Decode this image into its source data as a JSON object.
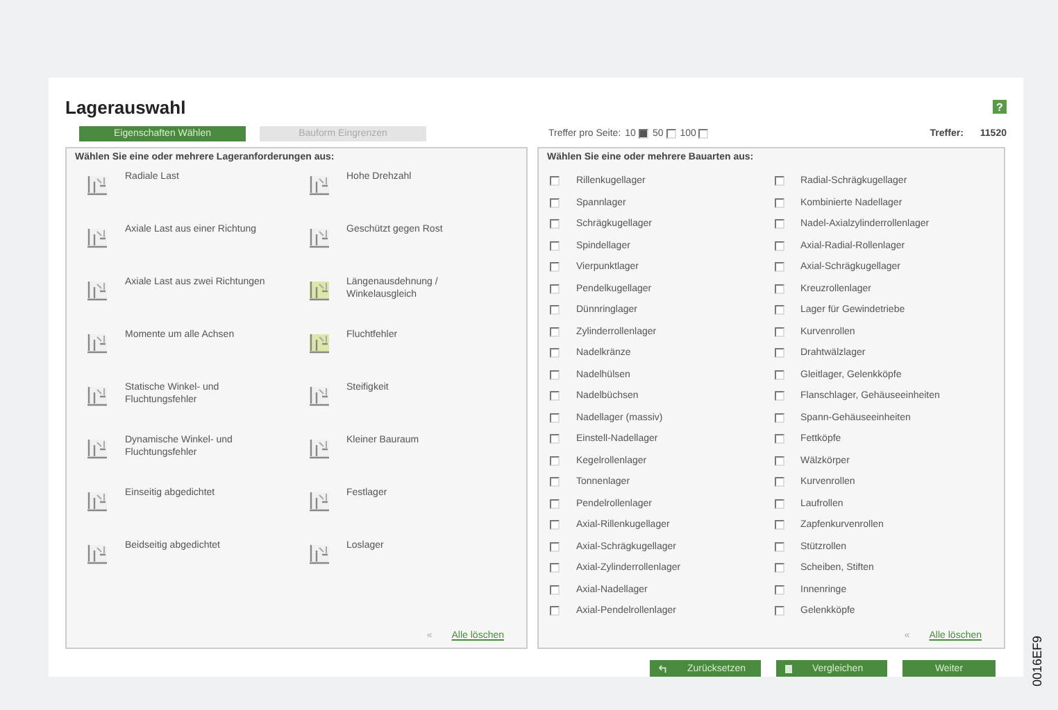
{
  "window": {
    "title": "Lagerauswahl",
    "help": "?"
  },
  "tabs": [
    {
      "label": "Eigenschaften Wählen",
      "selected": true
    },
    {
      "label": "Bauform Eingrenzen",
      "selected": false
    }
  ],
  "per_page": {
    "label": "Treffer pro Seite:",
    "options": [
      {
        "label": "10",
        "selected": true
      },
      {
        "label": "50",
        "selected": false
      },
      {
        "label": "100",
        "selected": false
      }
    ]
  },
  "hits": {
    "label": "Treffer:",
    "value": "11520"
  },
  "requirements": {
    "heading": "Wählen Sie eine oder mehrere Lageranforderungen aus:",
    "items": [
      {
        "label": "Radiale Last",
        "highlight": false
      },
      {
        "label": "Hohe Drehzahl",
        "highlight": false
      },
      {
        "label": "Axiale Last aus einer Richtung",
        "highlight": false
      },
      {
        "label": "Geschützt gegen Rost",
        "highlight": false
      },
      {
        "label": "Axiale Last aus zwei Richtungen",
        "highlight": false
      },
      {
        "label": "Längenausdehnung / Winkelausgleich",
        "highlight": true
      },
      {
        "label": "Momente um alle Achsen",
        "highlight": false
      },
      {
        "label": "Fluchtfehler",
        "highlight": true
      },
      {
        "label": "Statische Winkel- und Fluchtungsfehler",
        "highlight": false
      },
      {
        "label": "Steifigkeit",
        "highlight": false
      },
      {
        "label": "Dynamische Winkel- und Fluchtungsfehler",
        "highlight": false
      },
      {
        "label": "Kleiner Bauraum",
        "highlight": false
      },
      {
        "label": "Einseitig abgedichtet",
        "highlight": false
      },
      {
        "label": "Festlager",
        "highlight": false
      },
      {
        "label": "Beidseitig abgedichtet",
        "highlight": false
      },
      {
        "label": "Loslager",
        "highlight": false
      }
    ],
    "clear_icon": "«",
    "clear": "Alle löschen"
  },
  "types": {
    "heading": "Wählen Sie eine oder mehrere Bauarten aus:",
    "items": [
      {
        "label": "Rillenkugellager",
        "checked": false
      },
      {
        "label": "Radial-Schrägkugellager",
        "checked": false
      },
      {
        "label": "Spannlager",
        "checked": false
      },
      {
        "label": "Kombinierte Nadellager",
        "checked": false
      },
      {
        "label": "Schrägkugellager",
        "checked": false
      },
      {
        "label": "Nadel-Axialzylinderrollenlager",
        "checked": false
      },
      {
        "label": "Spindellager",
        "checked": false
      },
      {
        "label": "Axial-Radial-Rollenlager",
        "checked": false
      },
      {
        "label": "Vierpunktlager",
        "checked": false
      },
      {
        "label": "Axial-Schrägkugellager",
        "checked": false
      },
      {
        "label": "Pendelkugellager",
        "checked": false
      },
      {
        "label": "Kreuzrollenlager",
        "checked": false
      },
      {
        "label": "Dünnringlager",
        "checked": false
      },
      {
        "label": "Lager für Gewindetriebe",
        "checked": false
      },
      {
        "label": "Zylinderrollenlager",
        "checked": false
      },
      {
        "label": "Kurvenrollen",
        "checked": false
      },
      {
        "label": "Nadelkränze",
        "checked": false
      },
      {
        "label": "Drahtwälzlager",
        "checked": false
      },
      {
        "label": "Nadelhülsen",
        "checked": false
      },
      {
        "label": "Gleitlager, Gelenkköpfe",
        "checked": false
      },
      {
        "label": "Nadelbüchsen",
        "checked": false
      },
      {
        "label": "Flanschlager, Gehäuseeinheiten",
        "checked": false
      },
      {
        "label": "Nadellager (massiv)",
        "checked": false
      },
      {
        "label": "Spann-Gehäuseeinheiten",
        "checked": false
      },
      {
        "label": "Einstell-Nadellager",
        "checked": false
      },
      {
        "label": "Fettköpfe",
        "checked": false
      },
      {
        "label": "Kegelrollenlager",
        "checked": false
      },
      {
        "label": "Wälzkörper",
        "checked": false
      },
      {
        "label": "Tonnenlager",
        "checked": false
      },
      {
        "label": "Kurvenrollen",
        "checked": false
      },
      {
        "label": "Pendelrollenlager",
        "checked": false
      },
      {
        "label": "Laufrollen",
        "checked": false
      },
      {
        "label": "Axial-Rillenkugellager",
        "checked": false
      },
      {
        "label": "Zapfenkurvenrollen",
        "checked": false
      },
      {
        "label": "Axial-Schrägkugellager",
        "checked": false
      },
      {
        "label": "Stützrollen",
        "checked": false
      },
      {
        "label": "Axial-Zylinderrollenlager",
        "checked": false
      },
      {
        "label": "Scheiben, Stiften",
        "checked": false
      },
      {
        "label": "Axial-Nadellager",
        "checked": false
      },
      {
        "label": "Innenringe",
        "checked": false
      },
      {
        "label": "Axial-Pendelrollenlager",
        "checked": false
      },
      {
        "label": "Gelenkköpfe",
        "checked": false
      }
    ],
    "clear_icon": "«",
    "clear": "Alle löschen"
  },
  "buttons": [
    {
      "label": "Zurücksetzen",
      "kind": "reset"
    },
    {
      "label": "Vergleichen",
      "kind": "compare"
    },
    {
      "label": "Weiter",
      "kind": "plain"
    }
  ],
  "figure_id": "0016EF9"
}
